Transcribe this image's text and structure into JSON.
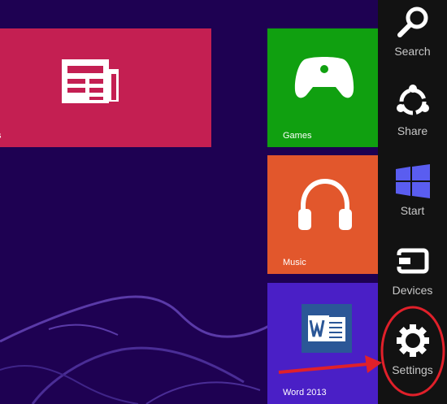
{
  "tiles": {
    "news": {
      "label": "s",
      "color": "#c41f52"
    },
    "games": {
      "label": "Games",
      "color": "#10a010"
    },
    "music": {
      "label": "Music",
      "color": "#e2572c"
    },
    "word": {
      "label": "Word 2013",
      "color": "#4a1fc6"
    }
  },
  "charms": {
    "search": {
      "label": "Search",
      "icon": "search-icon"
    },
    "share": {
      "label": "Share",
      "icon": "share-icon"
    },
    "start": {
      "label": "Start",
      "icon": "windows-logo-icon"
    },
    "devices": {
      "label": "Devices",
      "icon": "devices-icon"
    },
    "settings": {
      "label": "Settings",
      "icon": "gear-icon"
    }
  },
  "colors": {
    "background": "#1e0152",
    "charms_bar": "#121212",
    "annotation": "#e0202a"
  }
}
